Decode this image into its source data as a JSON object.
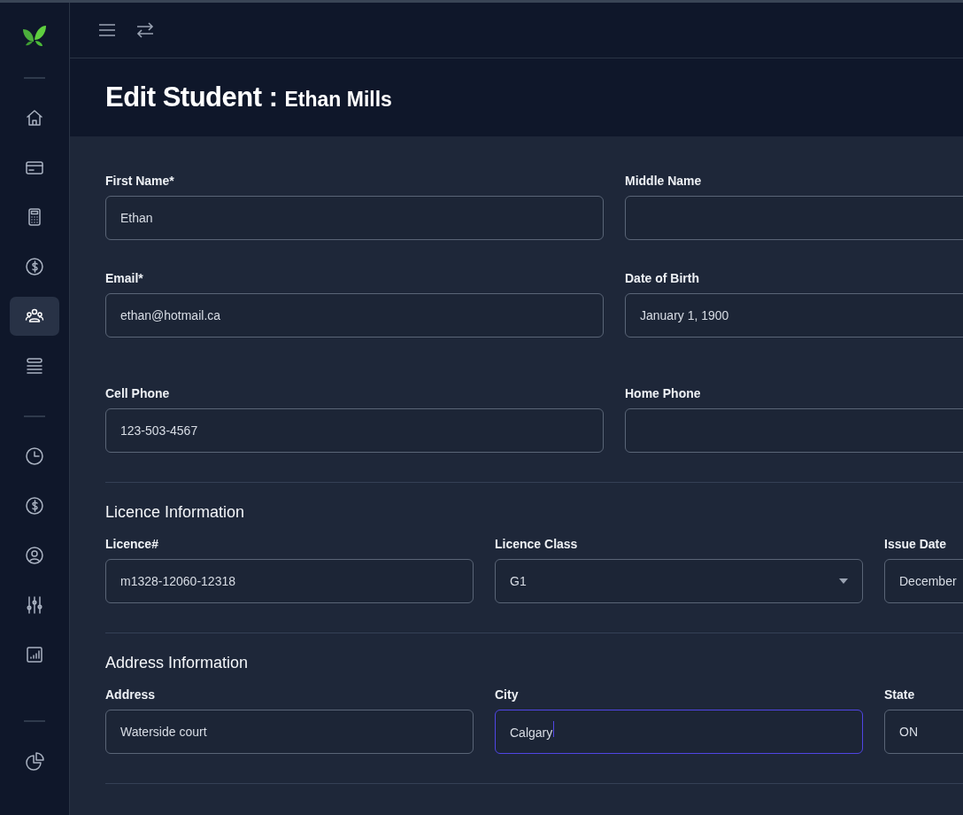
{
  "sidebar": {
    "groups": [
      [
        {
          "selected": false
        },
        {
          "selected": false
        },
        {
          "selected": false
        },
        {
          "selected": false
        },
        {
          "selected": true
        },
        {
          "selected": false
        }
      ],
      [
        {
          "selected": false
        },
        {
          "selected": false
        },
        {
          "selected": false
        },
        {
          "selected": false
        },
        {
          "selected": false
        }
      ],
      [
        {
          "selected": false
        }
      ]
    ]
  },
  "page": {
    "title": "Edit Student :",
    "subtitle": "Ethan Mills"
  },
  "sections": [
    {
      "rows": [
        [
          {
            "label": "First Name*",
            "kind": "text",
            "value": "Ethan",
            "focused": false
          },
          {
            "label": "Middle Name",
            "kind": "text",
            "focused": false
          }
        ],
        [
          {
            "label": "Email*",
            "kind": "text",
            "value": "ethan@hotmail.ca",
            "focused": false
          },
          {
            "label": "Date of Birth",
            "kind": "text",
            "value": "January 1, 1900",
            "focused": false
          }
        ],
        [
          {
            "label": "Cell Phone",
            "kind": "text",
            "value": "123-503-4567",
            "focused": false
          },
          {
            "label": "Home Phone",
            "kind": "text",
            "focused": false
          }
        ]
      ]
    },
    {
      "heading": "Licence Information",
      "rows": [
        [
          {
            "label": "Licence#",
            "kind": "text",
            "value": "m1328-12060-12318",
            "focused": false
          },
          {
            "label": "Licence Class",
            "kind": "select",
            "value": "G1",
            "focused": false
          },
          {
            "label": "Issue Date",
            "kind": "text",
            "value": "December",
            "focused": false
          }
        ]
      ]
    },
    {
      "heading": "Address Information",
      "rows": [
        [
          {
            "label": "Address",
            "kind": "text",
            "value": "Waterside court",
            "focused": false
          },
          {
            "label": "City",
            "kind": "text",
            "value": "Calgary",
            "focused": true
          },
          {
            "label": "State",
            "kind": "text",
            "value": "ON",
            "focused": false
          }
        ]
      ]
    }
  ]
}
